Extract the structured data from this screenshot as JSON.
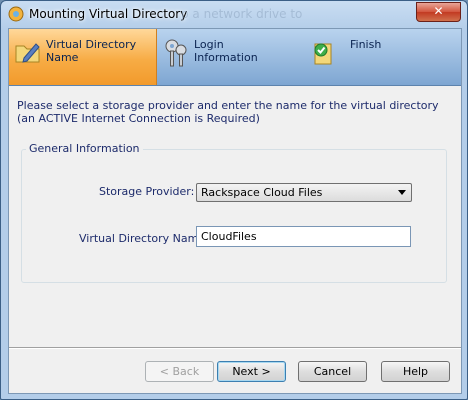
{
  "window": {
    "title": "Mounting Virtual Directory",
    "background_text": "p a network drive to",
    "close_label": "✕"
  },
  "steps": [
    {
      "label_line1": "Virtual Directory",
      "label_line2": "Name",
      "active": true,
      "icon": "folder-pencil-icon"
    },
    {
      "label_line1": "Login",
      "label_line2": "Information",
      "active": false,
      "icon": "keys-icon"
    },
    {
      "label_line1": "Finish",
      "label_line2": "",
      "active": false,
      "icon": "folder-check-icon"
    }
  ],
  "instructions": "Please select a storage provider and enter the name for the virtual directory (an ACTIVE Internet Connection is Required)",
  "group": {
    "title": "General Information",
    "storage_provider_label": "Storage Provider:",
    "storage_provider_value": "Rackspace Cloud Files",
    "vdir_name_label": "Virtual Directory Name",
    "vdir_name_value": "CloudFiles"
  },
  "buttons": {
    "back": "< Back",
    "next": "Next >",
    "cancel": "Cancel",
    "help": "Help"
  },
  "colors": {
    "active_step": "#f7ac45",
    "step_bar": "#7ea6d2",
    "text_blue": "#1d2b6b"
  }
}
